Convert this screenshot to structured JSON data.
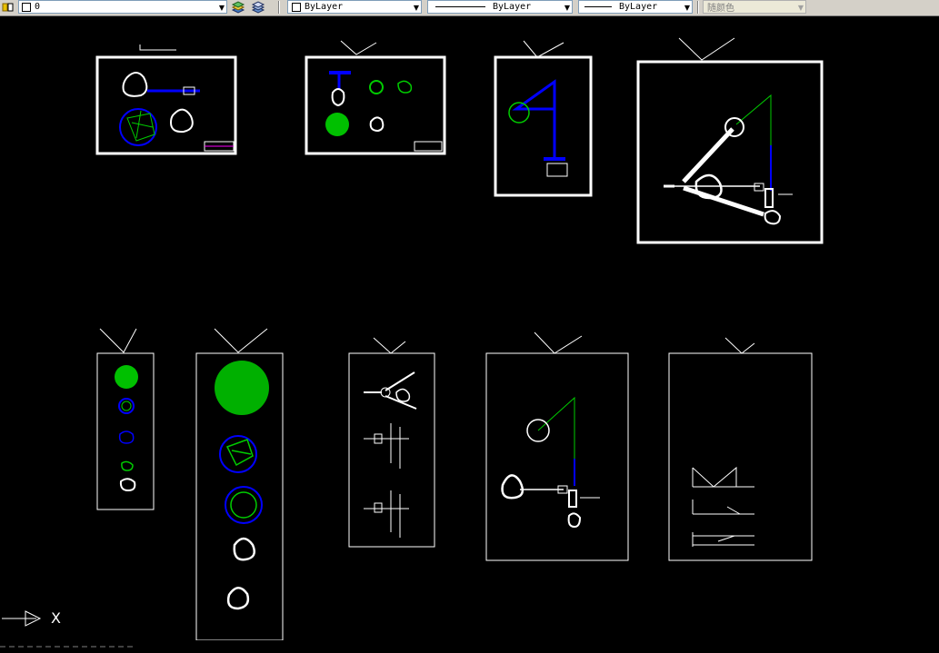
{
  "toolbar": {
    "layer": {
      "name": "0"
    },
    "color": {
      "value": "ByLayer"
    },
    "linetype": {
      "value": "ByLayer"
    },
    "lineweight": {
      "value": "ByLayer"
    },
    "plotstyle": {
      "value": "随颜色"
    }
  },
  "ucs": {
    "x_label": "X"
  },
  "colors": {
    "background": "#000000",
    "frame": "#ffffff",
    "geometry_green": "#00c800",
    "geometry_blue": "#0000ff",
    "toolbar_bg": "#d4d0c8"
  },
  "icons": [
    "layer-properties-icon",
    "layer-state-icon",
    "layer-previous-icon",
    "ucs-icon",
    "dropdown-arrow-icon"
  ]
}
